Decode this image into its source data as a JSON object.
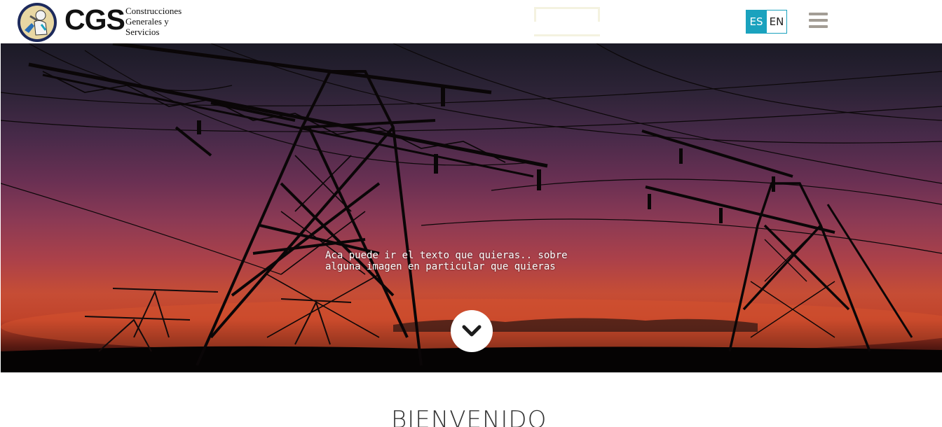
{
  "header": {
    "logo": {
      "brand": "CGS",
      "subtitle_lines": [
        "Construcciones",
        "Generales y",
        "Servicios"
      ]
    },
    "languages": [
      {
        "code": "ES",
        "active": true
      },
      {
        "code": "EN",
        "active": false
      }
    ],
    "menu_icon": "hamburger-menu-icon"
  },
  "hero": {
    "caption": "Aca puede ir el texto que quieras.. sobre alguna imagen en particular que quieras",
    "scroll_icon": "chevron-down-icon"
  },
  "welcome": {
    "title": "BIENVENIDO"
  },
  "colors": {
    "accent": "#1aa2be",
    "menu_icon": "#a39d95",
    "text_dark": "#111111"
  }
}
